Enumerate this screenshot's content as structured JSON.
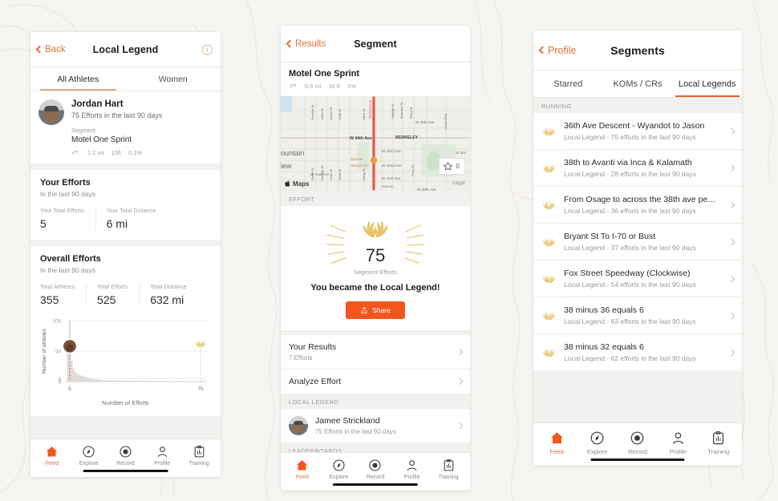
{
  "theme": {
    "brand_orange": "#f4551d",
    "accent_orange": "#e8703a",
    "gold": "#e8c368",
    "canvas": "#f7f5f2",
    "card": "#ffffff",
    "group_bg": "#f2f1ef"
  },
  "panel_local_legend": {
    "nav": {
      "back_label": "Back",
      "title": "Local Legend",
      "info_icon": "info-circle-icon",
      "info_glyph": "i"
    },
    "tabs": [
      {
        "label": "All Athletes",
        "active": true
      },
      {
        "label": "Women",
        "active": false
      }
    ],
    "athlete": {
      "avatar": "athlete-avatar",
      "name": "Jordan Hart",
      "efforts_line": "75 Efforts in the last 90 days",
      "segment_label": "Segment",
      "segment_name": "Motel One Sprint",
      "segment_icon": "route-icon",
      "stats": [
        "1.2 mi",
        "10ft",
        "0.1%"
      ]
    },
    "your_efforts": {
      "title": "Your Efforts",
      "subtitle": "In the last 90 days",
      "stats": [
        {
          "key": "Your Total Efforts",
          "value": "5"
        },
        {
          "key": "Your Total Distance",
          "value": "6 mi"
        }
      ]
    },
    "overall_efforts": {
      "title": "Overall Efforts",
      "subtitle": "In the last 90 days",
      "stats": [
        {
          "key": "Total Athletes",
          "value": "355"
        },
        {
          "key": "Total Efforts",
          "value": "525"
        },
        {
          "key": "Total Distance",
          "value": "632 mi"
        }
      ]
    }
  },
  "chart_data": {
    "type": "bar",
    "title": "",
    "xlabel": "Number of Efforts",
    "ylabel": "Number of athletes",
    "xticks": [
      "5",
      "75"
    ],
    "xtick_values": [
      5,
      75
    ],
    "yticks": [
      "0",
      "5",
      "50",
      "100"
    ],
    "ytick_values": [
      0,
      5,
      50,
      100
    ],
    "ylim": [
      0,
      100
    ],
    "xlim": [
      3,
      78
    ],
    "grid": true,
    "legend": false,
    "bar_color": "#dcdad7",
    "categories": [
      4,
      5,
      6,
      7,
      8,
      9,
      10,
      11,
      12,
      13,
      14,
      15,
      16,
      17,
      18,
      19,
      20,
      21,
      22,
      23,
      24,
      25,
      26,
      27,
      28,
      29,
      30,
      31,
      32,
      33,
      34,
      35,
      36,
      37,
      38,
      40,
      42,
      44,
      46,
      48,
      50,
      55,
      60,
      65,
      70,
      75
    ],
    "values": [
      62,
      100,
      34,
      22,
      16,
      13,
      11,
      10,
      9,
      8,
      7,
      6,
      5,
      5,
      4,
      4,
      3,
      3,
      3,
      2,
      2,
      2,
      2,
      2,
      2,
      2,
      1,
      1,
      1,
      1,
      1,
      1,
      1,
      1,
      1,
      1,
      2,
      1,
      1,
      1,
      1,
      1,
      1,
      1,
      1,
      1
    ],
    "markers": [
      {
        "name": "you-marker",
        "x": 5,
        "label_icon": "athlete-avatar",
        "line_color": "#e05a4a",
        "line_style": "dashed"
      },
      {
        "name": "legend-marker",
        "x": 75,
        "label_icon": "laurel-icon",
        "line_color": "#e8c368",
        "line_style": "dotted"
      }
    ]
  },
  "panel_segment": {
    "nav": {
      "back_label": "Results",
      "title": "Segment"
    },
    "segment": {
      "name": "Motel One Sprint",
      "icon": "route-icon",
      "stats": [
        "0.5 mi",
        "30 ft",
        "1%"
      ]
    },
    "map": {
      "attribution": "Maps",
      "apple_glyph": "",
      "star_icon": "star-outline-icon",
      "star_count": "0",
      "legal": "Legal",
      "labels": [
        "BERKELEY",
        "W 44th Ave",
        "W 45th Ave",
        "W 43rd Ave",
        "W 42nd Ave",
        "W 41st Ave",
        "W 39th Ave",
        "W 42nd",
        "Denver Biscuit Co.",
        "Tennyson St",
        "Perry St",
        "Quitman St",
        "Raleigh St",
        "Stuart St",
        "Irving St",
        "Julian St",
        "Knox Ct",
        "Lowell Blvd",
        "Zenobia St",
        "Eliot St",
        "Wolff St",
        "Utica St",
        "ountain iew"
      ]
    },
    "effort_header": "EFFORT",
    "trophy": {
      "icon": "laurel-icon",
      "count": "75",
      "caption": "Segment Efforts",
      "message": "You became the Local Legend!",
      "share_icon": "share-icon",
      "share_label": "Share"
    },
    "rows": [
      {
        "title": "Your Results",
        "sub": "7 Efforts",
        "chevron": "chevron-right-icon"
      },
      {
        "title": "Analyze Effort",
        "sub": "",
        "chevron": "chevron-right-icon"
      }
    ],
    "local_legend_header": "LOCAL LEGEND",
    "local_legend": {
      "avatar": "athlete-avatar",
      "name": "Jamee Strickland",
      "sub": "75 Efforts in the last 90 days",
      "chevron": "chevron-right-icon"
    },
    "leaderboards_header": "LEADERBOARDS"
  },
  "panel_segments": {
    "nav": {
      "back_label": "Profile",
      "title": "Segments"
    },
    "tabs": [
      {
        "label": "Starred",
        "active": false
      },
      {
        "label": "KOMs / CRs",
        "active": false
      },
      {
        "label": "Local Legends",
        "active": true
      }
    ],
    "section_header": "RUNNING",
    "rows": [
      {
        "icon": "laurel-icon",
        "title": "36th Ave Descent - Wyandot to Jason",
        "sub": "Local Legend - 75 efforts in the last 90 days",
        "chevron": "chevron-right-icon"
      },
      {
        "icon": "laurel-icon",
        "title": "38th to Avanti via Inca & Kalamath",
        "sub": "Local Legend - 28 efforts in the last 90 days",
        "chevron": "chevron-right-icon"
      },
      {
        "icon": "laurel-icon",
        "title": "From Osage to across the 38th ave pe…",
        "sub": "Local Legend - 36 efforts in the last 90 days",
        "chevron": "chevron-right-icon"
      },
      {
        "icon": "laurel-icon",
        "title": "Bryant St To I-70 or Bust",
        "sub": "Local Legend - 37 efforts in the last 90 days",
        "chevron": "chevron-right-icon"
      },
      {
        "icon": "laurel-icon",
        "title": "Fox Street Speedway (Clockwise)",
        "sub": "Local Legend - 54 efforts in the last 90 days",
        "chevron": "chevron-right-icon"
      },
      {
        "icon": "laurel-icon",
        "title": "38 minus 36 equals 6",
        "sub": "Local Legend - 63 efforts in the last 90 days",
        "chevron": "chevron-right-icon"
      },
      {
        "icon": "laurel-icon",
        "title": "38 minus 32 equals 6",
        "sub": "Local Legend - 62 efforts in the last 90 days",
        "chevron": "chevron-right-icon"
      }
    ]
  },
  "tabbar": {
    "items": [
      {
        "label": "Feed",
        "icon": "home-icon",
        "active": true
      },
      {
        "label": "Explore",
        "icon": "compass-icon",
        "active": false
      },
      {
        "label": "Record",
        "icon": "record-dot-icon",
        "active": false
      },
      {
        "label": "Profile",
        "icon": "person-icon",
        "active": false
      },
      {
        "label": "Training",
        "icon": "clipboard-chart-icon",
        "active": false
      }
    ]
  }
}
